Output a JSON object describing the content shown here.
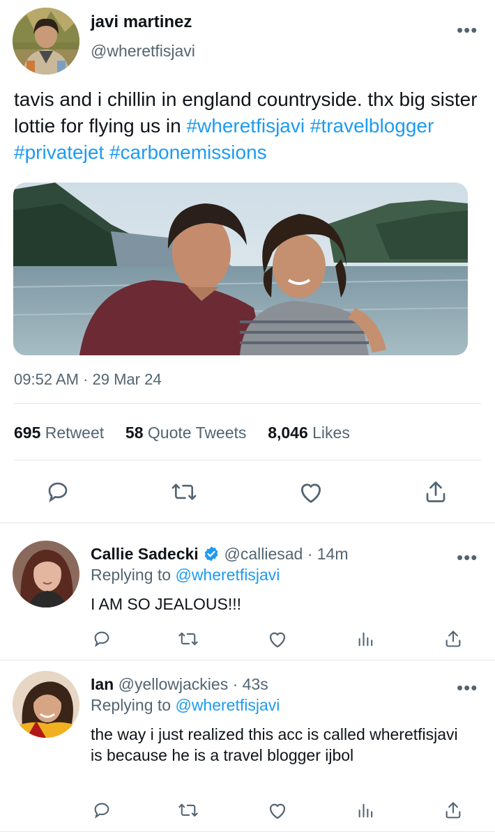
{
  "colors": {
    "accent": "#1d9bf0",
    "text": "#0f1419",
    "secondary": "#536471",
    "verified": "#1d9bf0"
  },
  "main_tweet": {
    "author_name": "javi martinez",
    "author_handle": "@wheretfisjavi",
    "text_plain": "tavis and i chillin in england countryside. thx big sister lottie for flying us in",
    "hashtags": [
      "#wheretfisjavi",
      "#travelblogger",
      "#privatejet",
      "#carbonemissions"
    ],
    "timestamp": "09:52 AM · 29 Mar 24",
    "stats": [
      {
        "count": "695",
        "label": "Retweet"
      },
      {
        "count": "58",
        "label": "Quote Tweets"
      },
      {
        "count": "8,046",
        "label": "Likes"
      }
    ],
    "actions": [
      "reply-icon",
      "retweet-icon",
      "like-icon",
      "share-icon"
    ]
  },
  "replies": [
    {
      "name": "Callie Sadecki",
      "verified": true,
      "handle": "@calliesad",
      "time": "· 14m",
      "replying_prefix": "Replying to",
      "replying_handle": "@wheretfisjavi",
      "text": "I AM SO JEALOUS!!!",
      "actions": [
        "reply-icon",
        "retweet-icon",
        "like-icon",
        "analytics-icon",
        "share-icon"
      ]
    },
    {
      "name": "Ian",
      "verified": false,
      "handle": "@yellowjackies",
      "time": "· 43s",
      "replying_prefix": "Replying to",
      "replying_handle": "@wheretfisjavi",
      "text": "the way i just realized this acc is called wheretfisjavi is because he is a travel blogger ijbol",
      "actions": [
        "reply-icon",
        "retweet-icon",
        "like-icon",
        "analytics-icon",
        "share-icon"
      ]
    }
  ]
}
